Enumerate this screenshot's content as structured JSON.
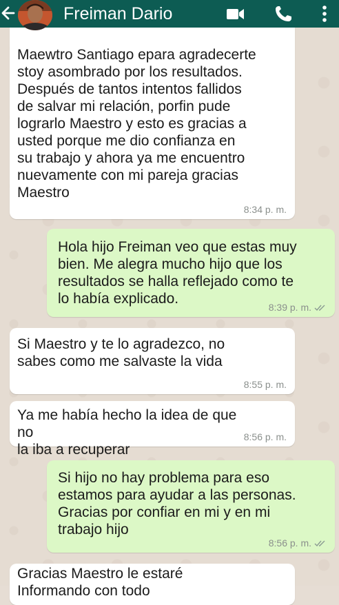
{
  "header": {
    "contact_name": "Freiman Dario",
    "icons": {
      "back": "arrow-left-icon",
      "avatar": "profile-avatar",
      "video": "video-camera-icon",
      "call": "phone-icon",
      "menu": "more-vertical-icon"
    },
    "background_color": "#0d5c53"
  },
  "messages": [
    {
      "direction": "incoming",
      "text": "Maewtro Santiago epara agradecerte\nstoy asombrado por los resultados.\nDespués de tantos intentos fallidos\nde salvar mi relación, porfin pude\nlograrlo Maestro y esto es gracias a\nusted porque me dio confianza en\nsu trabajo y ahora ya me encuentro\nnuevamente con mi pareja gracias\nMaestro",
      "time": "8:34 p. m."
    },
    {
      "direction": "outgoing",
      "text": "Hola hijo Freiman veo que estas muy\nbien. Me alegra mucho hijo que los\nresultados se halla reflejado como te\nlo había explicado.",
      "time": "8:39 p. m.",
      "status": "read-double-check"
    },
    {
      "direction": "incoming",
      "text": "Si Maestro y te lo agradezco,  no\nsabes como me salvaste la vida",
      "time": "8:55 p. m."
    },
    {
      "direction": "incoming",
      "text": "Ya me había hecho la idea de que no\nla iba a recuperar",
      "time": "8:56 p. m."
    },
    {
      "direction": "outgoing",
      "text": "Si hijo no hay problema para eso\nestamos para ayudar a las personas.\nGracias por confiar en mi y en mi\ntrabajo hijo",
      "time": "8:56 p. m.",
      "status": "read-double-check"
    },
    {
      "direction": "incoming",
      "text": "Gracias Maestro le estaré\nInformando con todo",
      "time": ""
    }
  ],
  "colors": {
    "incoming_bubble": "#ffffff",
    "outgoing_bubble": "#dcf8c6",
    "timestamp": "#8a8f8c",
    "read_ticks": "#8a9a92",
    "wallpaper": "#e5dcd2"
  }
}
